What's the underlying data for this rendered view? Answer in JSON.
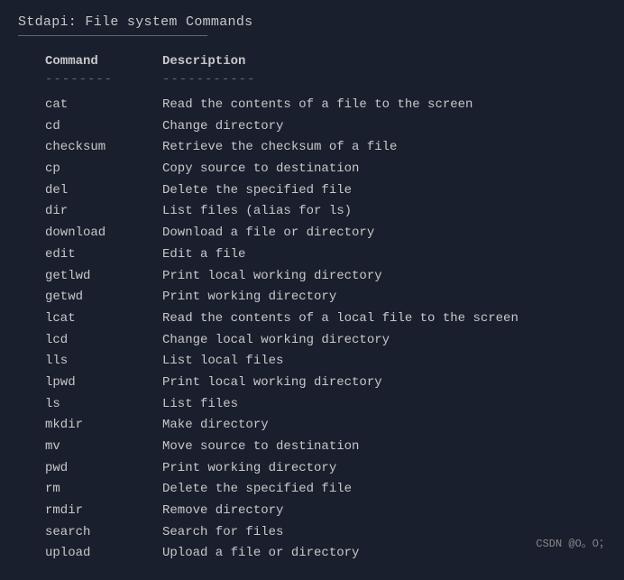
{
  "title": "Stdapi: File system Commands",
  "table": {
    "headers": {
      "command": "Command",
      "description": "Description"
    },
    "rows": [
      {
        "command": "cat",
        "description": "Read the contents of a file to the screen"
      },
      {
        "command": "cd",
        "description": "Change directory"
      },
      {
        "command": "checksum",
        "description": "Retrieve the checksum of a file"
      },
      {
        "command": "cp",
        "description": "Copy source to destination"
      },
      {
        "command": "del",
        "description": "Delete the specified file"
      },
      {
        "command": "dir",
        "description": "List files (alias for ls)"
      },
      {
        "command": "download",
        "description": "Download a file or directory"
      },
      {
        "command": "edit",
        "description": "Edit a file"
      },
      {
        "command": "getlwd",
        "description": "Print local working directory"
      },
      {
        "command": "getwd",
        "description": "Print working directory"
      },
      {
        "command": "lcat",
        "description": "Read the contents of a local file to the screen"
      },
      {
        "command": "lcd",
        "description": "Change local working directory"
      },
      {
        "command": "lls",
        "description": "List local files"
      },
      {
        "command": "lpwd",
        "description": "Print local working directory"
      },
      {
        "command": "ls",
        "description": "List files"
      },
      {
        "command": "mkdir",
        "description": "Make directory"
      },
      {
        "command": "mv",
        "description": "Move source to destination"
      },
      {
        "command": "pwd",
        "description": "Print working directory"
      },
      {
        "command": "rm",
        "description": "Delete the specified file"
      },
      {
        "command": "rmdir",
        "description": "Remove directory"
      },
      {
        "command": "search",
        "description": "Search for files"
      },
      {
        "command": "upload",
        "description": "Upload a file or directory"
      }
    ]
  },
  "watermark": "CSDN @O。O；"
}
